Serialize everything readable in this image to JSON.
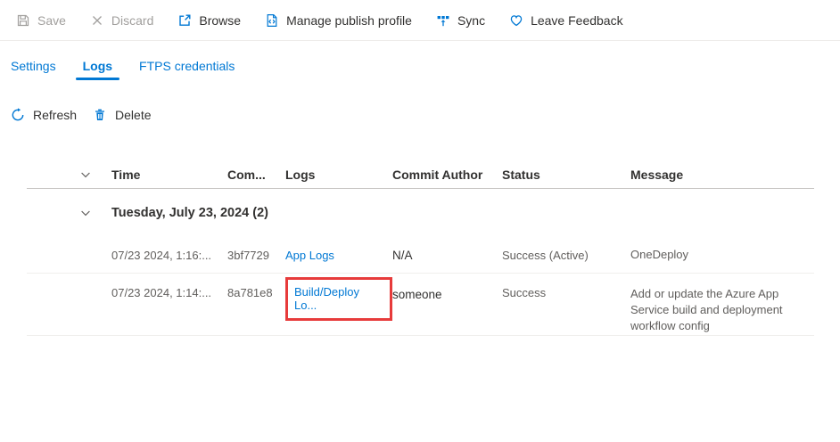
{
  "colors": {
    "accent": "#0078d4",
    "highlight_red": "#e73b3b",
    "disabled_gray": "#a19f9d"
  },
  "toolbar": {
    "save": "Save",
    "discard": "Discard",
    "browse": "Browse",
    "manage": "Manage publish profile",
    "sync": "Sync",
    "feedback": "Leave Feedback"
  },
  "tabs": {
    "settings": "Settings",
    "logs": "Logs",
    "ftps": "FTPS credentials"
  },
  "actions": {
    "refresh": "Refresh",
    "delete": "Delete"
  },
  "table": {
    "columns": {
      "time": "Time",
      "commit": "Com...",
      "logs": "Logs",
      "author": "Commit Author",
      "status": "Status",
      "message": "Message"
    },
    "group_label": "Tuesday, July 23, 2024 (2)",
    "rows": [
      {
        "time": "07/23 2024, 1:16:...",
        "commit": "3bf7729",
        "logs": "App Logs",
        "author": "N/A",
        "status": "Success (Active)",
        "message": "OneDeploy"
      },
      {
        "time": "07/23 2024, 1:14:...",
        "commit": "8a781e8",
        "logs": "Build/Deploy Lo...",
        "author": "someone",
        "status": "Success",
        "message": "Add or update the Azure App Service build and deployment workflow config"
      }
    ]
  }
}
